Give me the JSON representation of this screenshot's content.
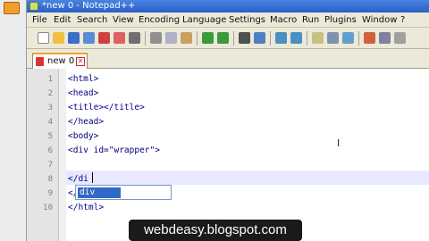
{
  "window": {
    "title": "*new  0 - Notepad++"
  },
  "menu": [
    "File",
    "Edit",
    "Search",
    "View",
    "Encoding",
    "Language",
    "Settings",
    "Macro",
    "Run",
    "Plugins",
    "Window",
    "?"
  ],
  "toolbar": {
    "icons": [
      "new-file-icon",
      "open-file-icon",
      "save-icon",
      "save-all-icon",
      "close-icon",
      "close-all-icon",
      "print-icon",
      "cut-icon",
      "copy-icon",
      "paste-icon",
      "undo-icon",
      "redo-icon",
      "find-icon",
      "replace-icon",
      "zoom-in-icon",
      "zoom-out-icon",
      "sync-scroll-icon",
      "wrap-icon",
      "indent-guide-icon"
    ]
  },
  "tab": {
    "label": "new  0",
    "close_glyph": "✕"
  },
  "editor": {
    "line_numbers": [
      "1",
      "2",
      "3",
      "4",
      "5",
      "6",
      "7",
      "8",
      "9",
      "10"
    ],
    "lines": [
      "<html>",
      "<head>",
      "<title></title>",
      "</head>",
      "<body>",
      "<div id=\"wrapper\">",
      "",
      "</di",
      "</",
      "</html>"
    ],
    "autocomplete": {
      "selected": "div"
    }
  },
  "colors": {
    "title_bar": "#2a5ec8",
    "menu_bg": "#ece9d8",
    "tab_accent": "#f0a030",
    "autocomplete_selected": "#3169c6",
    "line_highlight": "#e8e8ff"
  },
  "watermark": "webdeasy.blogspot.com"
}
